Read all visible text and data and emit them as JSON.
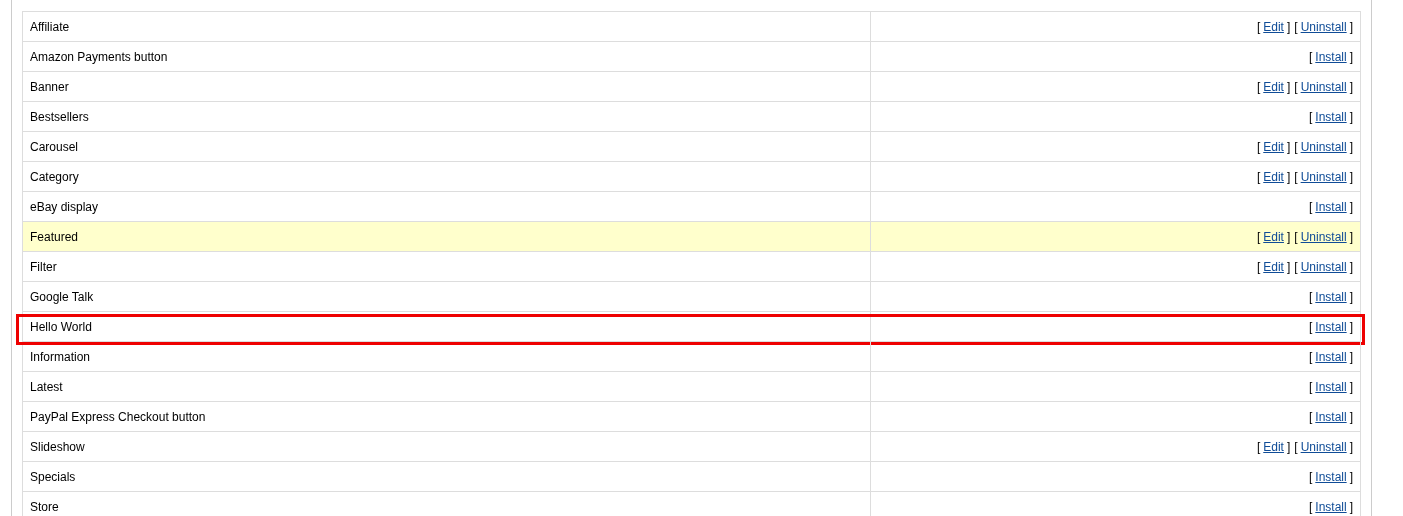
{
  "modules": [
    {
      "name": "Affiliate",
      "hovered": false,
      "marked": false,
      "actions": [
        {
          "open": "[",
          "label": "Edit",
          "close": "]"
        },
        {
          "open": "[",
          "label": "Uninstall",
          "close": "]"
        }
      ]
    },
    {
      "name": "Amazon Payments button",
      "hovered": false,
      "marked": false,
      "actions": [
        {
          "open": "[",
          "label": "Install",
          "close": "]"
        }
      ]
    },
    {
      "name": "Banner",
      "hovered": false,
      "marked": false,
      "actions": [
        {
          "open": "[",
          "label": "Edit",
          "close": "]"
        },
        {
          "open": "[",
          "label": "Uninstall",
          "close": "]"
        }
      ]
    },
    {
      "name": "Bestsellers",
      "hovered": false,
      "marked": false,
      "actions": [
        {
          "open": "[",
          "label": "Install",
          "close": "]"
        }
      ]
    },
    {
      "name": "Carousel",
      "hovered": false,
      "marked": false,
      "actions": [
        {
          "open": "[",
          "label": "Edit",
          "close": "]"
        },
        {
          "open": "[",
          "label": "Uninstall",
          "close": "]"
        }
      ]
    },
    {
      "name": "Category",
      "hovered": false,
      "marked": false,
      "actions": [
        {
          "open": "[",
          "label": "Edit",
          "close": "]"
        },
        {
          "open": "[",
          "label": "Uninstall",
          "close": "]"
        }
      ]
    },
    {
      "name": "eBay display",
      "hovered": false,
      "marked": false,
      "actions": [
        {
          "open": "[",
          "label": "Install",
          "close": "]"
        }
      ]
    },
    {
      "name": "Featured",
      "hovered": true,
      "marked": false,
      "actions": [
        {
          "open": "[",
          "label": "Edit",
          "close": "]"
        },
        {
          "open": "[",
          "label": "Uninstall",
          "close": "]"
        }
      ]
    },
    {
      "name": "Filter",
      "hovered": false,
      "marked": false,
      "actions": [
        {
          "open": "[",
          "label": "Edit",
          "close": "]"
        },
        {
          "open": "[",
          "label": "Uninstall",
          "close": "]"
        }
      ]
    },
    {
      "name": "Google Talk",
      "hovered": false,
      "marked": false,
      "actions": [
        {
          "open": "[",
          "label": "Install",
          "close": "]"
        }
      ]
    },
    {
      "name": "Hello World",
      "hovered": false,
      "marked": true,
      "actions": [
        {
          "open": "[",
          "label": "Install",
          "close": "]"
        }
      ]
    },
    {
      "name": "Information",
      "hovered": false,
      "marked": false,
      "actions": [
        {
          "open": "[",
          "label": "Install",
          "close": "]"
        }
      ]
    },
    {
      "name": "Latest",
      "hovered": false,
      "marked": false,
      "actions": [
        {
          "open": "[",
          "label": "Install",
          "close": "]"
        }
      ]
    },
    {
      "name": "PayPal Express Checkout button",
      "hovered": false,
      "marked": false,
      "actions": [
        {
          "open": "[",
          "label": "Install",
          "close": "]"
        }
      ]
    },
    {
      "name": "Slideshow",
      "hovered": false,
      "marked": false,
      "actions": [
        {
          "open": "[",
          "label": "Edit",
          "close": "]"
        },
        {
          "open": "[",
          "label": "Uninstall",
          "close": "]"
        }
      ]
    },
    {
      "name": "Specials",
      "hovered": false,
      "marked": false,
      "actions": [
        {
          "open": "[",
          "label": "Install",
          "close": "]"
        }
      ]
    },
    {
      "name": "Store",
      "hovered": false,
      "marked": false,
      "actions": [
        {
          "open": "[",
          "label": "Install",
          "close": "]"
        }
      ]
    }
  ]
}
